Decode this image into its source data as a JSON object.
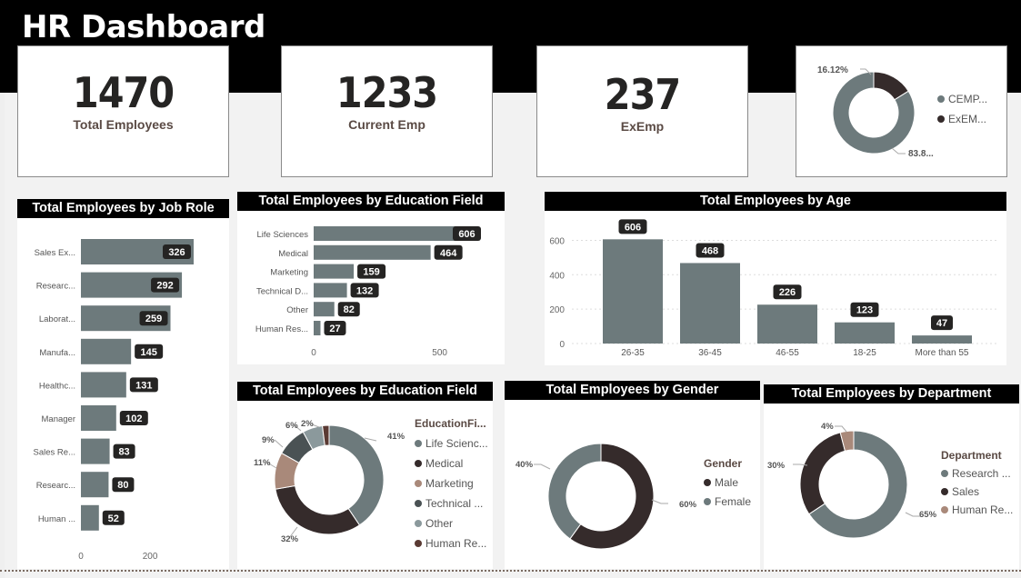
{
  "header": {
    "title": "HR Dashboard"
  },
  "kpis": [
    {
      "value": "1470",
      "label": "Total Employees"
    },
    {
      "value": "1233",
      "label": "Current Emp"
    },
    {
      "value": "237",
      "label": "ExEmp"
    }
  ],
  "colors": {
    "gray": "#6d7a7c",
    "dark": "#352b2b",
    "tan": "#a9897a",
    "slate": "#4a5254",
    "lightgray": "#8b999c",
    "brown": "#5a3a33",
    "pill": "#252423"
  },
  "chart_data": [
    {
      "id": "attrition",
      "type": "pie",
      "title": "",
      "categories": [
        "CEMP...",
        "ExEM..."
      ],
      "values": [
        83.88,
        16.12
      ],
      "labels": [
        "83.8...",
        "16.12%"
      ]
    },
    {
      "id": "jobrole",
      "type": "bar",
      "title": "Total Employees by Job Role",
      "categories": [
        "Sales Ex...",
        "Researc...",
        "Laborat...",
        "Manufa...",
        "Healthc...",
        "Manager",
        "Sales Re...",
        "Researc...",
        "Human ..."
      ],
      "values": [
        326,
        292,
        259,
        145,
        131,
        102,
        83,
        80,
        52
      ],
      "xticks": [
        "0",
        "200"
      ],
      "xlim": [
        0,
        326
      ]
    },
    {
      "id": "edu",
      "type": "bar",
      "title": "Total Employees by Education Field",
      "categories": [
        "Life Sciences",
        "Medical",
        "Marketing",
        "Technical D...",
        "Other",
        "Human Res..."
      ],
      "values": [
        606,
        464,
        159,
        132,
        82,
        27
      ],
      "xticks": [
        "0",
        "500"
      ],
      "xlim": [
        0,
        606
      ]
    },
    {
      "id": "age",
      "type": "bar",
      "title": "Total Employees by Age",
      "categories": [
        "26-35",
        "36-45",
        "46-55",
        "18-25",
        "More than 55"
      ],
      "values": [
        606,
        468,
        226,
        123,
        47
      ],
      "yticks": [
        "0",
        "200",
        "400",
        "600"
      ],
      "ylim": [
        0,
        650
      ]
    },
    {
      "id": "edupie",
      "type": "pie",
      "title": "Total Employees by Education Field",
      "legend_title": "EducationFi...",
      "categories": [
        "Life Scienc...",
        "Medical",
        "Marketing",
        "Technical ...",
        "Other",
        "Human Re..."
      ],
      "values": [
        41,
        32,
        11,
        9,
        6,
        2
      ],
      "labels": [
        "41%",
        "32%",
        "11%",
        "9%",
        "6%",
        "2%"
      ]
    },
    {
      "id": "gender",
      "type": "pie",
      "title": "Total Employees by Gender",
      "legend_title": "Gender",
      "categories": [
        "Male",
        "Female"
      ],
      "values": [
        60,
        40
      ],
      "labels": [
        "60%",
        "40%"
      ]
    },
    {
      "id": "dept",
      "type": "pie",
      "title": "Total Employees by Department",
      "legend_title": "Department",
      "categories": [
        "Research ...",
        "Sales",
        "Human Re..."
      ],
      "values": [
        65,
        30,
        4
      ],
      "labels": [
        "65%",
        "30%",
        "4%"
      ]
    }
  ]
}
